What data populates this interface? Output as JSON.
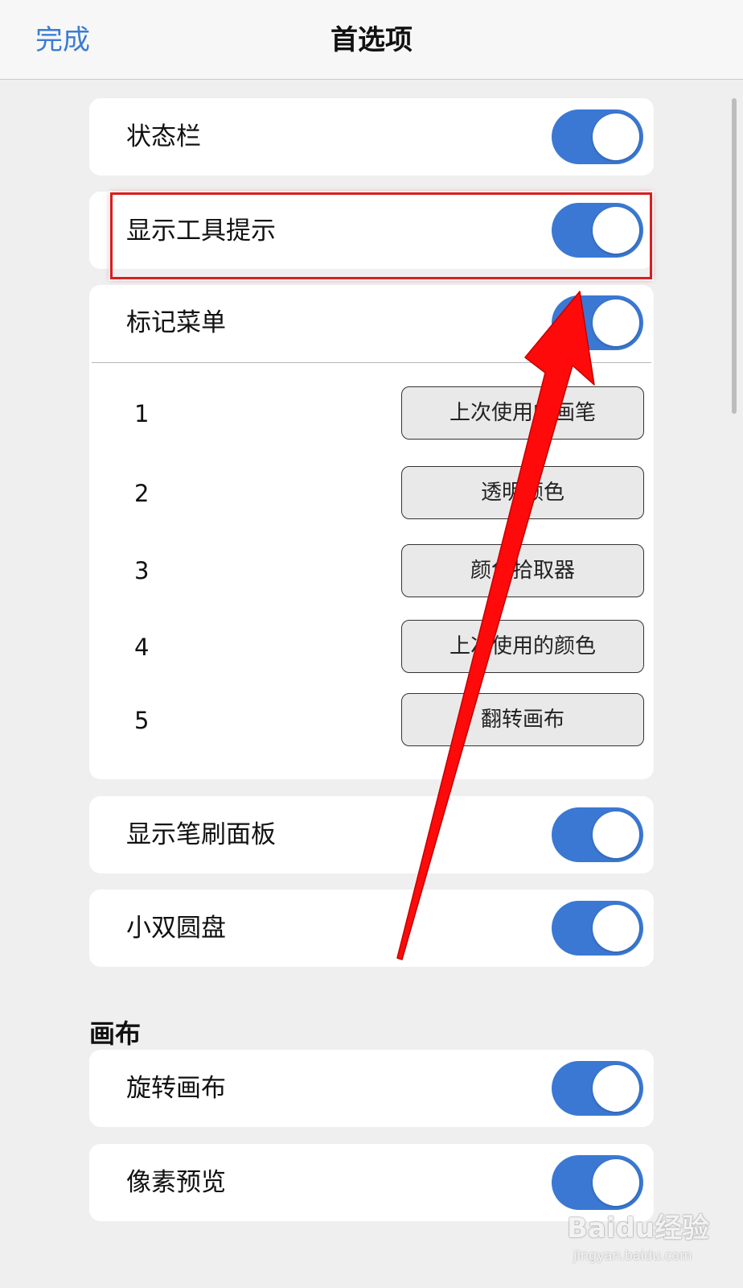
{
  "header": {
    "done_label": "完成",
    "title": "首选项"
  },
  "settings": {
    "status_bar": {
      "label": "状态栏",
      "on": true
    },
    "show_tooltips": {
      "label": "显示工具提示",
      "on": true
    },
    "mark_menu": {
      "label": "标记菜单",
      "on": true,
      "slots": [
        {
          "number": "1",
          "action": "上次使用的画笔"
        },
        {
          "number": "2",
          "action": "透明颜色"
        },
        {
          "number": "3",
          "action": "颜色拾取器"
        },
        {
          "number": "4",
          "action": "上次使用的颜色"
        },
        {
          "number": "5",
          "action": "翻转画布"
        }
      ]
    },
    "show_brush_panel": {
      "label": "显示笔刷面板",
      "on": true
    },
    "mini_dual_disc": {
      "label": "小双圆盘",
      "on": true
    }
  },
  "canvas_section": {
    "title": "画布",
    "rotate_canvas": {
      "label": "旋转画布",
      "on": true
    },
    "pixel_preview": {
      "label": "像素预览",
      "on": true
    }
  },
  "annotation": {
    "highlight_color": "#d81e1e",
    "arrow_color": "#ff0a0a"
  },
  "watermark": {
    "main": "Baidu经验",
    "sub": "jingyan.baidu.com"
  },
  "colors": {
    "accent": "#3a78d3",
    "link": "#3b7cd4",
    "background": "#efeff0"
  }
}
